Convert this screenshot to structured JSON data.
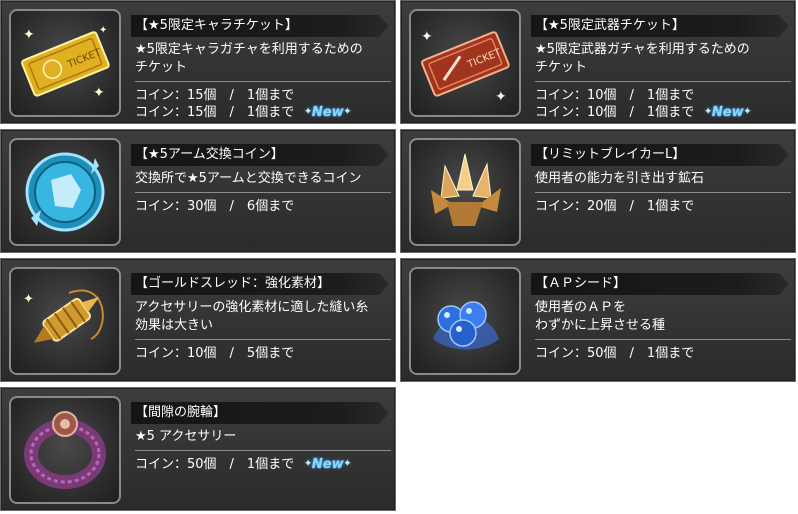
{
  "items": [
    {
      "title": "【★5限定キャラチケット】",
      "desc": [
        "★5限定キャラガチャを利用するための",
        "チケット"
      ],
      "coins": [
        "コイン：15個　/　1個まで",
        "コイン：15個　/　1個まで"
      ],
      "new_label": "New",
      "icon": "gold-ticket-icon"
    },
    {
      "title": "【★5限定武器チケット】",
      "desc": [
        "★5限定武器ガチャを利用するための",
        "チケット"
      ],
      "coins": [
        "コイン：10個　/　1個まで",
        "コイン：10個　/　1個まで"
      ],
      "new_label": "New",
      "icon": "red-ticket-icon"
    },
    {
      "title": "【★5アーム交換コイン】",
      "desc": [
        "交換所で★5アームと交換できるコイン"
      ],
      "coins": [
        "コイン：30個　/　6個まで"
      ],
      "icon": "arm-coin-icon"
    },
    {
      "title": "【リミットブレイカーL】",
      "desc": [
        "使用者の能力を引き出す鉱石"
      ],
      "coins": [
        "コイン：20個　/　1個まで"
      ],
      "icon": "crystal-ore-icon"
    },
    {
      "title": "【ゴールドスレッド：強化素材】",
      "desc": [
        "アクセサリーの強化素材に適した縫い糸",
        "効果は大きい"
      ],
      "coins": [
        "コイン：10個　/　5個まで"
      ],
      "icon": "gold-thread-icon"
    },
    {
      "title": "【ＡＰシード】",
      "desc": [
        "使用者のＡＰを",
        "わずかに上昇させる種"
      ],
      "coins": [
        "コイン：50個　/　1個まで"
      ],
      "icon": "ap-seed-icon"
    },
    {
      "title": "【間隙の腕輪】",
      "desc": [
        "★5 アクセサリー"
      ],
      "coins": [
        "コイン：50個　/　1個まで"
      ],
      "new_label": "New",
      "icon": "bracelet-icon"
    }
  ],
  "colors": {
    "card_bg": "#333333",
    "title_bar": "#151515",
    "new": "#7fd8ff"
  }
}
